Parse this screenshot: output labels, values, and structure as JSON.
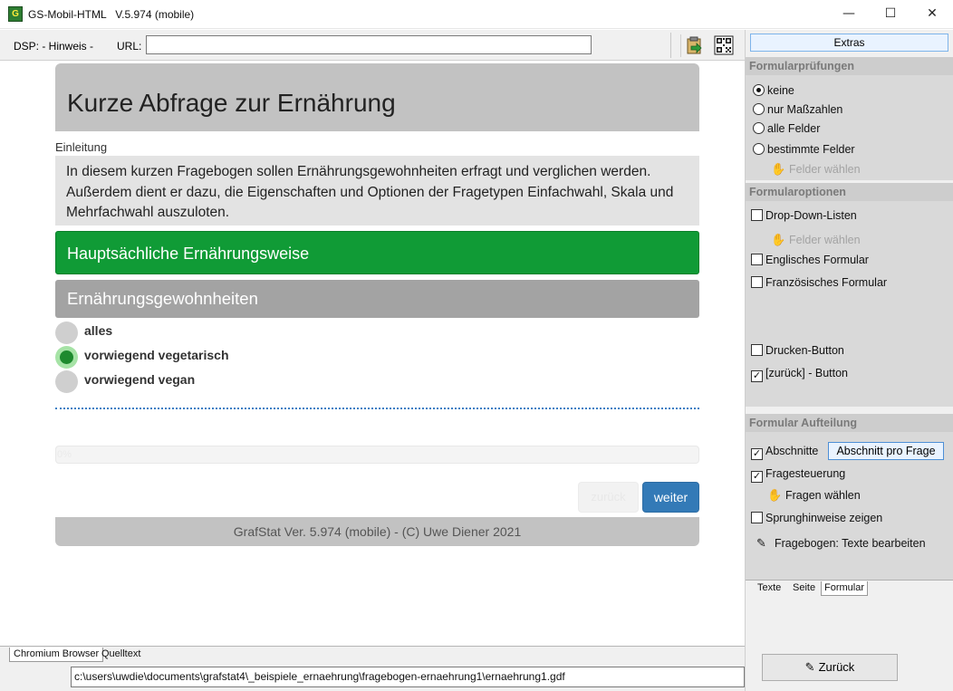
{
  "window": {
    "app_icon_text": "G",
    "title": "GS-Mobil-HTML   V.5.974 (mobile)",
    "minimize": "—",
    "maximize": "☐",
    "close": "✕"
  },
  "toolbar": {
    "dsp_label": "DSP: - Hinweis -",
    "url_label": "URL:",
    "url_value": "",
    "icons": [
      "clipboard-export-icon",
      "qr-code-icon"
    ]
  },
  "form": {
    "title": "Kurze Abfrage zur Ernährung",
    "intro_label": "Einleitung",
    "intro_text": "In diesem kurzen Fragebogen sollen Ernährungsgewohnheiten erfragt und verglichen werden. Außerdem dient er dazu, die Eigenschaften und Optionen der Fragetypen Einfachwahl, Skala und Mehrfachwahl auszuloten.",
    "section_title": "Hauptsächliche Ernährungsweise",
    "question_title": "Ernährungsgewohnheiten",
    "options": [
      {
        "label": "alles",
        "selected": false
      },
      {
        "label": "vorwiegend vegetarisch",
        "selected": true
      },
      {
        "label": "vorwiegend vegan",
        "selected": false
      }
    ],
    "progress_text": "0%",
    "progress_value": 0,
    "back_label": "zurück",
    "next_label": "weiter",
    "footer": "GrafStat Ver. 5.974 (mobile) - (C) Uwe Diener 2021"
  },
  "bottom": {
    "tabs": [
      "Chromium Browser",
      "Quelltext"
    ],
    "active_tab": "Chromium Browser",
    "path": "c:\\users\\uwdie\\documents\\grafstat4\\_beispiele_ernaehrung\\fragebogen-ernaehrung1\\ernaehrung1.gdf"
  },
  "panel": {
    "extras_label": "Extras",
    "pruefungen": {
      "header": "Formularprüfungen",
      "options": [
        "keine",
        "nur Maßzahlen",
        "alle Felder",
        "bestimmte Felder"
      ],
      "selected": "keine",
      "select_fields": "Felder wählen"
    },
    "optionen": {
      "header": "Formularoptionen",
      "dropdown": "Drop-Down-Listen",
      "select_fields": "Felder wählen",
      "english": "Englisches Formular",
      "french": "Französisches Formular",
      "print": "Drucken-Button",
      "back": "[zurück] - Button"
    },
    "aufteilung": {
      "header": "Formular Aufteilung",
      "sections": "Abschnitte",
      "section_per_question": "Abschnitt pro Frage",
      "question_control": "Fragesteuerung",
      "choose_questions": "Fragen wählen",
      "jump_hints": "Sprunghinweise zeigen",
      "edit_texts": "Fragebogen: Texte bearbeiten"
    },
    "tabs": [
      "Texte",
      "Seite",
      "Formular"
    ],
    "active_tab": "Formular",
    "zurueck_label": "Zurück"
  }
}
